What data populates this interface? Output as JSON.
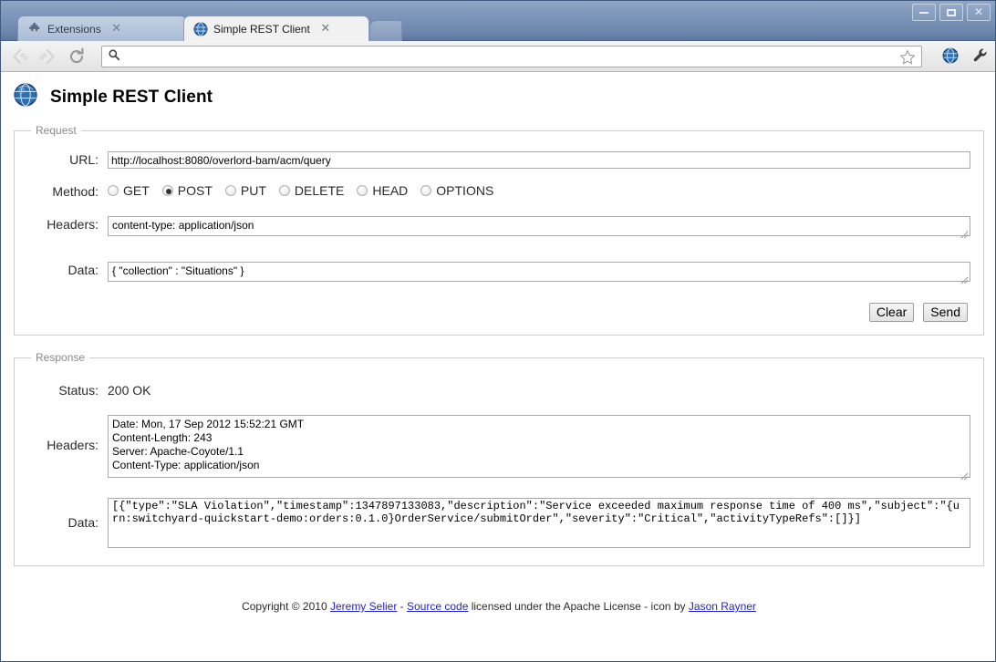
{
  "browser": {
    "window_controls": {
      "minimize": "–",
      "maximize": "□",
      "close": "✕"
    },
    "tabs": [
      {
        "label": "Extensions",
        "icon": "puzzle-piece-icon",
        "close": "✕",
        "active": false
      },
      {
        "label": "Simple REST Client",
        "icon": "globe-icon",
        "close": "✕",
        "active": true
      }
    ],
    "toolbar": {
      "back_icon": "back-arrow-icon",
      "forward_icon": "forward-arrow-icon",
      "reload_icon": "reload-icon",
      "search_icon": "search-icon",
      "omnibox_value": "",
      "omnibox_placeholder": "",
      "star_icon": "star-icon",
      "extension_icon": "globe-extension-icon",
      "menu_icon": "wrench-icon"
    }
  },
  "page": {
    "title": "Simple REST Client",
    "app_icon": "globe-icon",
    "request": {
      "legend": "Request",
      "url_label": "URL:",
      "url_value": "http://localhost:8080/overlord-bam/acm/query",
      "method_label": "Method:",
      "methods": [
        {
          "label": "GET",
          "selected": false
        },
        {
          "label": "POST",
          "selected": true
        },
        {
          "label": "PUT",
          "selected": false
        },
        {
          "label": "DELETE",
          "selected": false
        },
        {
          "label": "HEAD",
          "selected": false
        },
        {
          "label": "OPTIONS",
          "selected": false
        }
      ],
      "headers_label": "Headers:",
      "headers_value": "content-type: application/json",
      "data_label": "Data:",
      "data_value": "{ \"collection\" : \"Situations\" }",
      "clear_label": "Clear",
      "send_label": "Send"
    },
    "response": {
      "legend": "Response",
      "status_label": "Status:",
      "status_value": "200 OK",
      "headers_label": "Headers:",
      "headers_value": "Date: Mon, 17 Sep 2012 15:52:21 GMT\nContent-Length: 243\nServer: Apache-Coyote/1.1\nContent-Type: application/json",
      "data_label": "Data:",
      "data_value": "[{\"type\":\"SLA Violation\",\"timestamp\":1347897133083,\"description\":\"Service exceeded maximum response time of 400 ms\",\"subject\":\"{urn:switchyard-quickstart-demo:orders:0.1.0}OrderService/submitOrder\",\"severity\":\"Critical\",\"activityTypeRefs\":[]}]"
    },
    "footer": {
      "copyright_prefix": "Copyright © 2010 ",
      "author_link": "Jeremy Selier",
      "separator1": " - ",
      "source_link": "Source code",
      "license_text": " licensed under the Apache License - icon by ",
      "icon_author_link": "Jason Rayner"
    }
  },
  "colors": {
    "titlebar_top": "#8fa6c6",
    "titlebar_bottom": "#5d789f",
    "active_tab": "#f1f1f1",
    "inactive_tab": "#b6c7dd",
    "link": "#2222cc",
    "legend_text": "#8a8a8a"
  }
}
